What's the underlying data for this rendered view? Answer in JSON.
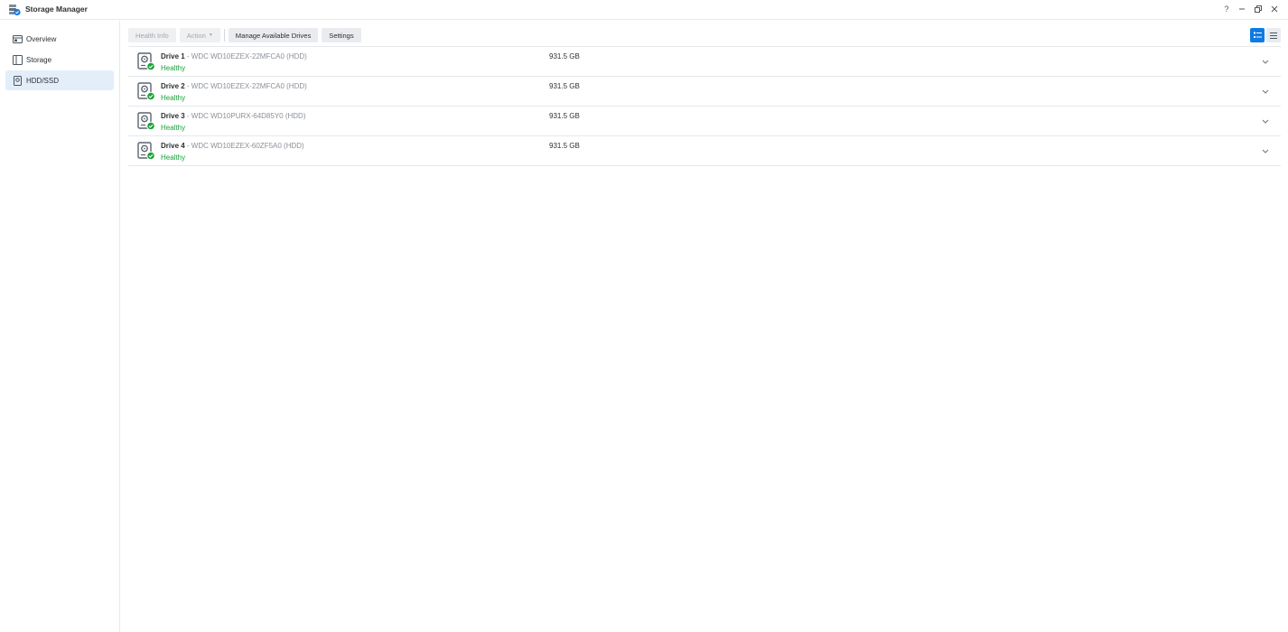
{
  "app": {
    "title": "Storage Manager",
    "icon": "storage-manager-app-icon"
  },
  "window_controls": {
    "help": "?",
    "minimize": "–",
    "restore": "❐",
    "close": "✕"
  },
  "sidebar": {
    "items": [
      {
        "label": "Overview",
        "icon": "overview-icon",
        "active": false
      },
      {
        "label": "Storage",
        "icon": "storage-icon",
        "active": false
      },
      {
        "label": "HDD/SSD",
        "icon": "hdd-icon",
        "active": true
      }
    ]
  },
  "toolbar": {
    "health_info_label": "Health Info",
    "action_label": "Action",
    "manage_drives_label": "Manage Available Drives",
    "settings_label": "Settings"
  },
  "drives": [
    {
      "name": "Drive 1",
      "separator": " - ",
      "model": "WDC WD10EZEX-22MFCA0 (HDD)",
      "status": "Healthy",
      "capacity": "931.5 GB"
    },
    {
      "name": "Drive 2",
      "separator": " - ",
      "model": "WDC WD10EZEX-22MFCA0 (HDD)",
      "status": "Healthy",
      "capacity": "931.5 GB"
    },
    {
      "name": "Drive 3",
      "separator": " - ",
      "model": "WDC WD10PURX-64D85Y0 (HDD)",
      "status": "Healthy",
      "capacity": "931.5 GB"
    },
    {
      "name": "Drive 4",
      "separator": " - ",
      "model": "WDC WD10EZEX-60ZF5A0 (HDD)",
      "status": "Healthy",
      "capacity": "931.5 GB"
    }
  ],
  "colors": {
    "accent": "#0f7ae5",
    "healthy": "#19a23a",
    "active_nav_bg": "#e3eefa"
  }
}
